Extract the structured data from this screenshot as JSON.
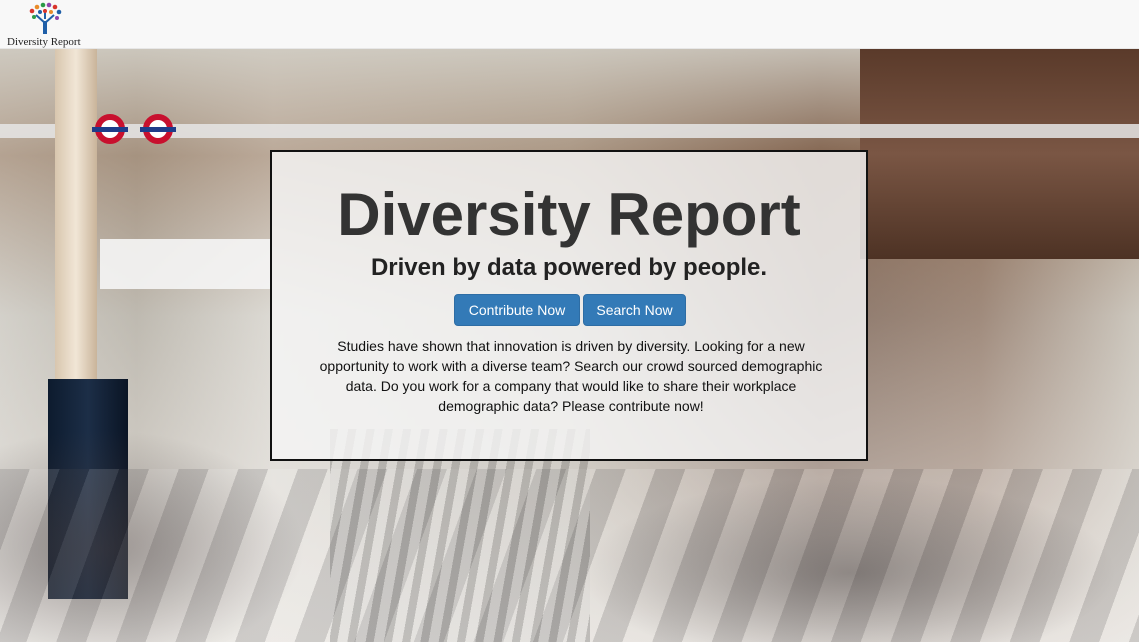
{
  "navbar": {
    "brand_label": "Diversity Report",
    "logo_icon": "tree-people-icon"
  },
  "hero": {
    "title": "Diversity Report",
    "subtitle": "Driven by data powered by people.",
    "buttons": {
      "contribute_label": "Contribute Now",
      "search_label": "Search Now"
    },
    "description": "Studies have shown that innovation is driven by diversity. Looking for a new opportunity to work with a diverse team? Search our crowd sourced demographic data. Do you work for a company that would like to share their workplace demographic data? Please contribute now!",
    "background_image": "busy-train-station-crowd"
  },
  "colors": {
    "primary_button": "#337ab7",
    "navbar_bg": "#f8f8f8",
    "title_text": "#333333"
  }
}
